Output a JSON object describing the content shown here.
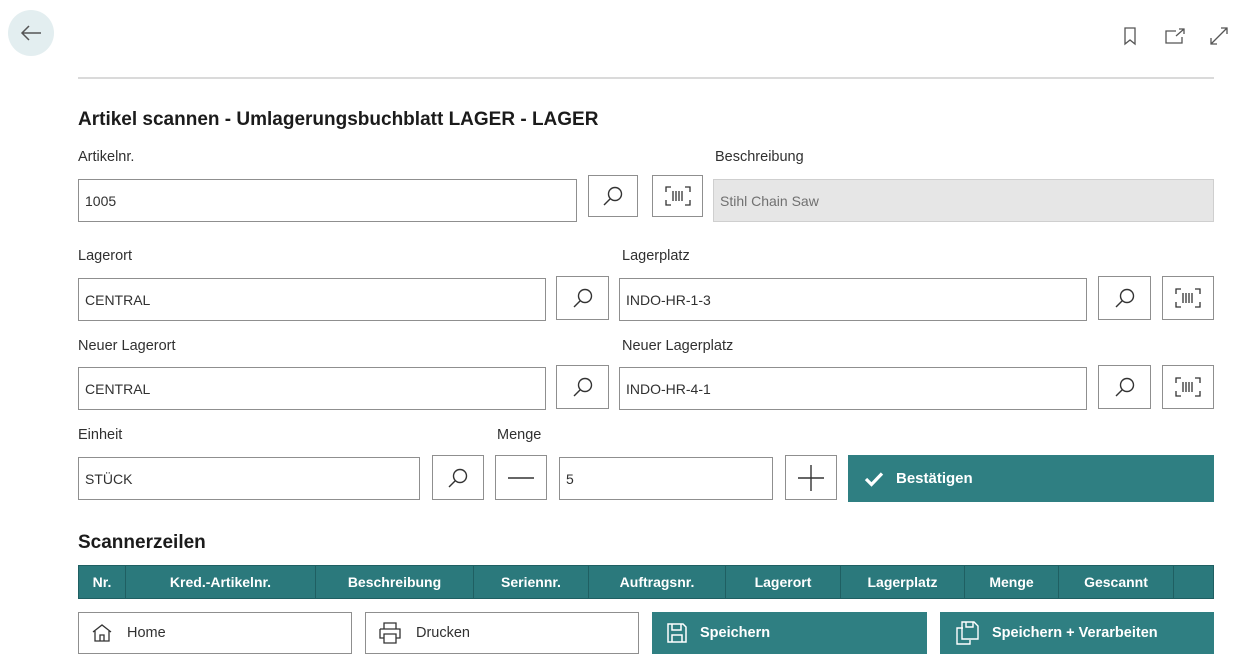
{
  "title": "Artikel scannen - Umlagerungsbuchblatt LAGER - LAGER",
  "fields": {
    "artikelnr": {
      "label": "Artikelnr.",
      "value": "1005"
    },
    "beschreibung": {
      "label": "Beschreibung",
      "value": "Stihl Chain Saw"
    },
    "lagerort": {
      "label": "Lagerort",
      "value": "CENTRAL"
    },
    "lagerplatz": {
      "label": "Lagerplatz",
      "value": "INDO-HR-1-3"
    },
    "neuer_lagerort": {
      "label": "Neuer Lagerort",
      "value": "CENTRAL"
    },
    "neuer_lagerplatz": {
      "label": "Neuer Lagerplatz",
      "value": "INDO-HR-4-1"
    },
    "einheit": {
      "label": "Einheit",
      "value": "STÜCK"
    },
    "menge": {
      "label": "Menge",
      "value": "5"
    }
  },
  "confirm_label": "Bestätigen",
  "section_title": "Scannerzeilen",
  "table_headers": [
    "Nr.",
    "Kred.-Artikelnr.",
    "Beschreibung",
    "Seriennr.",
    "Auftragsnr.",
    "Lagerort",
    "Lagerplatz",
    "Menge",
    "Gescannt",
    ""
  ],
  "buttons": {
    "home": "Home",
    "drucken": "Drucken",
    "speichern": "Speichern",
    "speichern_verarbeiten": "Speichern + Verarbeiten"
  },
  "colors": {
    "accent": "#2f7f82",
    "header": "#2b797c"
  }
}
